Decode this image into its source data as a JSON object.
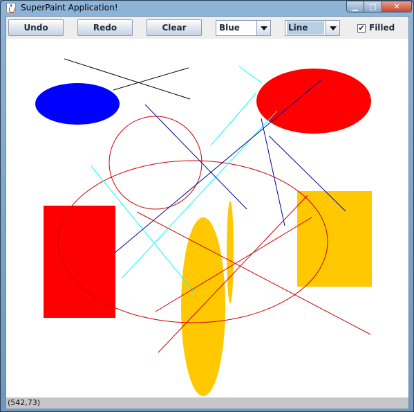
{
  "window": {
    "title": "SuperPaint Application!",
    "icon": "java-cup-icon",
    "controls": {
      "minimize": "▁",
      "maximize": "□",
      "close": "✕"
    }
  },
  "toolbar": {
    "undo_label": "Undo",
    "redo_label": "Redo",
    "clear_label": "Clear",
    "color_value": "Blue",
    "shape_value": "Line",
    "filled_label": "Filled",
    "filled_checked": true
  },
  "status": {
    "coordinates": "(542,73)"
  },
  "colors": {
    "blue": "#0000ff",
    "red": "#ff0000",
    "gold": "#ffc800",
    "cyan": "#00ffff",
    "black": "#000000",
    "navy": "#000099",
    "dark_red": "#cc0000"
  }
}
